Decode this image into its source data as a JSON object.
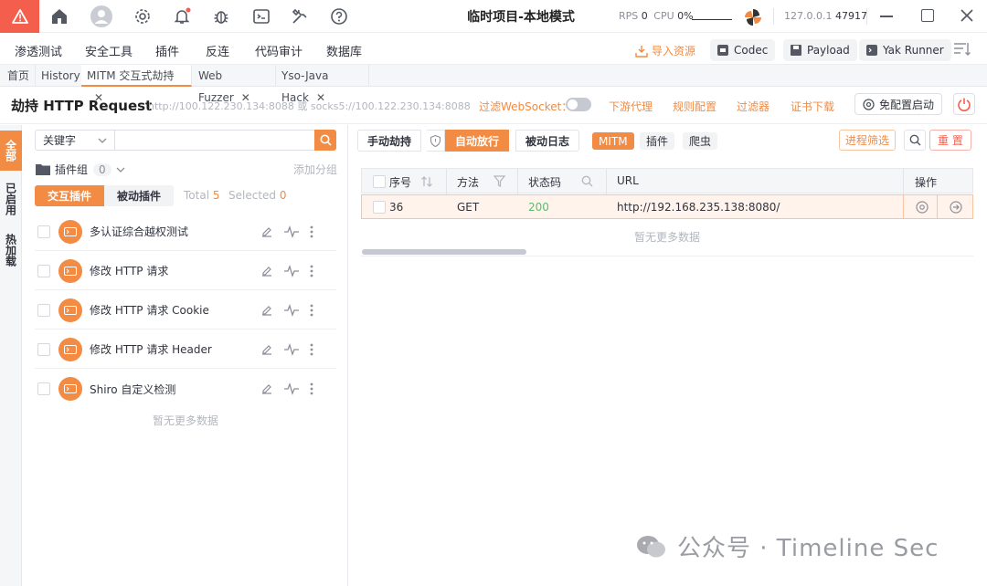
{
  "titlebar": {
    "app_title": "临时项目-本地模式",
    "rps_label": "RPS",
    "rps_value": "0",
    "cpu_label": "CPU",
    "cpu_value": "0%",
    "host_ip": "127.0.0.1",
    "host_port": "47917"
  },
  "menubar": {
    "items": [
      "渗透测试",
      "安全工具",
      "插件",
      "反连",
      "代码审计",
      "数据库"
    ],
    "import_label": "导入资源",
    "codec_label": "Codec",
    "payload_label": "Payload",
    "yakrunner_label": "Yak Runner"
  },
  "tabs": [
    {
      "label": "首页",
      "closable": false,
      "active": false
    },
    {
      "label": "History",
      "closable": false,
      "active": false
    },
    {
      "label": "MITM 交互式劫持",
      "closable": true,
      "active": true
    },
    {
      "label": "Web Fuzzer",
      "closable": true,
      "active": false
    },
    {
      "label": "Yso-Java Hack",
      "closable": true,
      "active": false
    }
  ],
  "header": {
    "title": "劫持 HTTP Request",
    "proxy_address": "http://100.122.230.134:8088 或 socks5://100.122.230.134:8088",
    "filter_websocket": "过滤WebSocket：",
    "downstream_proxy": "下游代理",
    "rule_config": "规则配置",
    "filter": "过滤器",
    "cert_download": "证书下载",
    "config_free_start": "免配置启动"
  },
  "side_tabs": [
    "全部",
    "已启用",
    "热加载"
  ],
  "plugin_panel": {
    "keyword_select": "关键字",
    "search_placeholder": "",
    "plugin_group_label": "插件组",
    "plugin_group_count": "0",
    "add_group": "添加分组",
    "interactive_plugins": "交互插件",
    "passive_plugins": "被动插件",
    "total_label": "Total",
    "total_value": "5",
    "selected_label": "Selected",
    "selected_value": "0",
    "plugins": [
      {
        "name": "多认证综合越权测试"
      },
      {
        "name": "修改 HTTP 请求"
      },
      {
        "name": "修改 HTTP 请求 Cookie"
      },
      {
        "name": "修改 HTTP 请求 Header"
      },
      {
        "name": "Shiro 自定义检测"
      }
    ],
    "no_more": "暂无更多数据"
  },
  "traffic_panel": {
    "manual_hijack": "手动劫持",
    "auto_release": "自动放行",
    "passive_log": "被动日志",
    "tags": [
      "MITM",
      "插件",
      "爬虫"
    ],
    "process_filter": "进程筛选",
    "reset": "重 置",
    "columns": [
      "序号",
      "方法",
      "状态码",
      "URL",
      "操作"
    ],
    "rows": [
      {
        "id": "36",
        "method": "GET",
        "status": "200",
        "url": "http://192.168.235.138:8080/"
      }
    ],
    "no_more": "暂无更多数据"
  },
  "watermark": "公众号 · Timeline Sec",
  "colors": {
    "accent": "#f28b44",
    "danger": "#f45e4c",
    "status_ok": "#56c16c"
  }
}
